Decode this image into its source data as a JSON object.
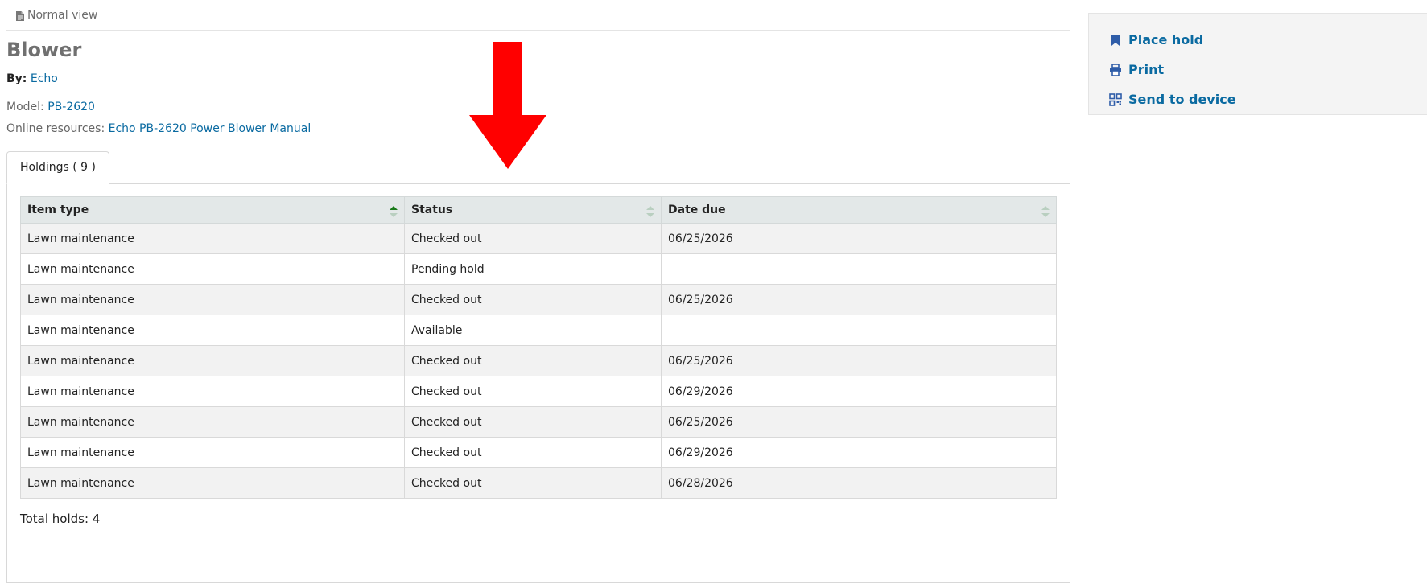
{
  "view_bar": {
    "label": "Normal view",
    "icon": "document-icon"
  },
  "record": {
    "title": "Blower",
    "by_label": "By:",
    "author": "Echo",
    "model_label": "Model:",
    "model": "PB-2620",
    "online_label": "Online resources:",
    "online_link": "Echo PB-2620 Power Blower Manual"
  },
  "tabs": [
    {
      "label": "Holdings ( 9 )"
    }
  ],
  "holdings": {
    "columns": [
      "Item type",
      "Status",
      "Date due"
    ],
    "rows": [
      {
        "type": "Lawn maintenance",
        "status": "Checked out",
        "due": "06/25/2026"
      },
      {
        "type": "Lawn maintenance",
        "status": "Pending hold",
        "due": ""
      },
      {
        "type": "Lawn maintenance",
        "status": "Checked out",
        "due": "06/25/2026"
      },
      {
        "type": "Lawn maintenance",
        "status": "Available",
        "due": ""
      },
      {
        "type": "Lawn maintenance",
        "status": "Checked out",
        "due": "06/25/2026"
      },
      {
        "type": "Lawn maintenance",
        "status": "Checked out",
        "due": "06/29/2026"
      },
      {
        "type": "Lawn maintenance",
        "status": "Checked out",
        "due": "06/25/2026"
      },
      {
        "type": "Lawn maintenance",
        "status": "Checked out",
        "due": "06/29/2026"
      },
      {
        "type": "Lawn maintenance",
        "status": "Checked out",
        "due": "06/28/2026"
      }
    ],
    "total_holds": "Total holds: 4"
  },
  "sidebar": {
    "actions": [
      {
        "label": "Place hold",
        "icon": "bookmark-icon"
      },
      {
        "label": "Print",
        "icon": "printer-icon"
      },
      {
        "label": "Send to device",
        "icon": "qr-code-icon"
      }
    ]
  },
  "colors": {
    "link": "#0a6aa1",
    "available": "#2e7d32",
    "annotation_arrow": "#ff0000",
    "sort_active": "#1a7a1a"
  }
}
